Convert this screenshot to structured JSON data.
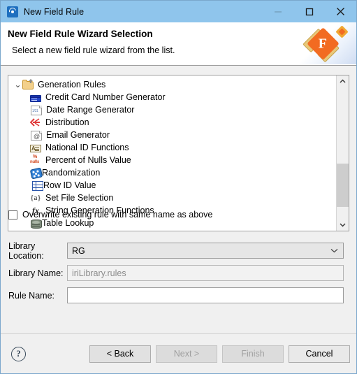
{
  "window": {
    "title": "New Field Rule",
    "icon": "app-swirl-icon",
    "minimize_label": "—",
    "maximize_label": "□",
    "close_label": "✕"
  },
  "header": {
    "title": "New Field Rule Wizard Selection",
    "subtitle": "Select a new field rule wizard from the list.",
    "logo_letter": "F",
    "accent_color": "#f26b21",
    "titlebar_color": "#8fc5ec"
  },
  "list": {
    "root": {
      "label": "Generation Rules",
      "icon": "open-folder-icon",
      "expanded": true,
      "twisty": "⌄"
    },
    "items": [
      {
        "label": "Credit Card Number Generator",
        "icon": "credit-card-icon"
      },
      {
        "label": "Date Range Generator",
        "icon": "calendar-document-icon",
        "mini": "1/31"
      },
      {
        "label": "Distribution",
        "icon": "distribution-arrow-icon"
      },
      {
        "label": "Email Generator",
        "icon": "email-document-icon",
        "mini": "@"
      },
      {
        "label": "National ID Functions",
        "icon": "national-id-icon"
      },
      {
        "label": "Percent of Nulls Value",
        "icon": "percent-nulls-icon",
        "mini_top": "%",
        "mini_bottom": "nulls"
      },
      {
        "label": "Randomization",
        "icon": "dice-icon"
      },
      {
        "label": "Row ID Value",
        "icon": "row-id-icon"
      },
      {
        "label": "Set File Selection",
        "icon": "set-braces-icon",
        "mini": "{a}"
      },
      {
        "label": "String Generation Functions",
        "icon": "function-fx-icon",
        "mini": "fx"
      },
      {
        "label": "Table Lookup",
        "icon": "database-icon"
      }
    ],
    "scroll_up": "∧",
    "scroll_down": "∨"
  },
  "form": {
    "library_location": {
      "label": "Library Location:",
      "value": "RG",
      "arrow": "⌄"
    },
    "library_name": {
      "label": "Library Name:",
      "value": "iriLibrary.rules",
      "readonly": true
    },
    "rule_name": {
      "label": "Rule Name:",
      "value": "",
      "placeholder": ""
    }
  },
  "overwrite": {
    "label": "Overwrite existing rule with same name as above",
    "checked": false
  },
  "footer": {
    "help_label": "?",
    "buttons": [
      {
        "label": "< Back",
        "enabled": true
      },
      {
        "label": "Next >",
        "enabled": false
      },
      {
        "label": "Finish",
        "enabled": false
      },
      {
        "label": "Cancel",
        "enabled": true
      }
    ]
  }
}
